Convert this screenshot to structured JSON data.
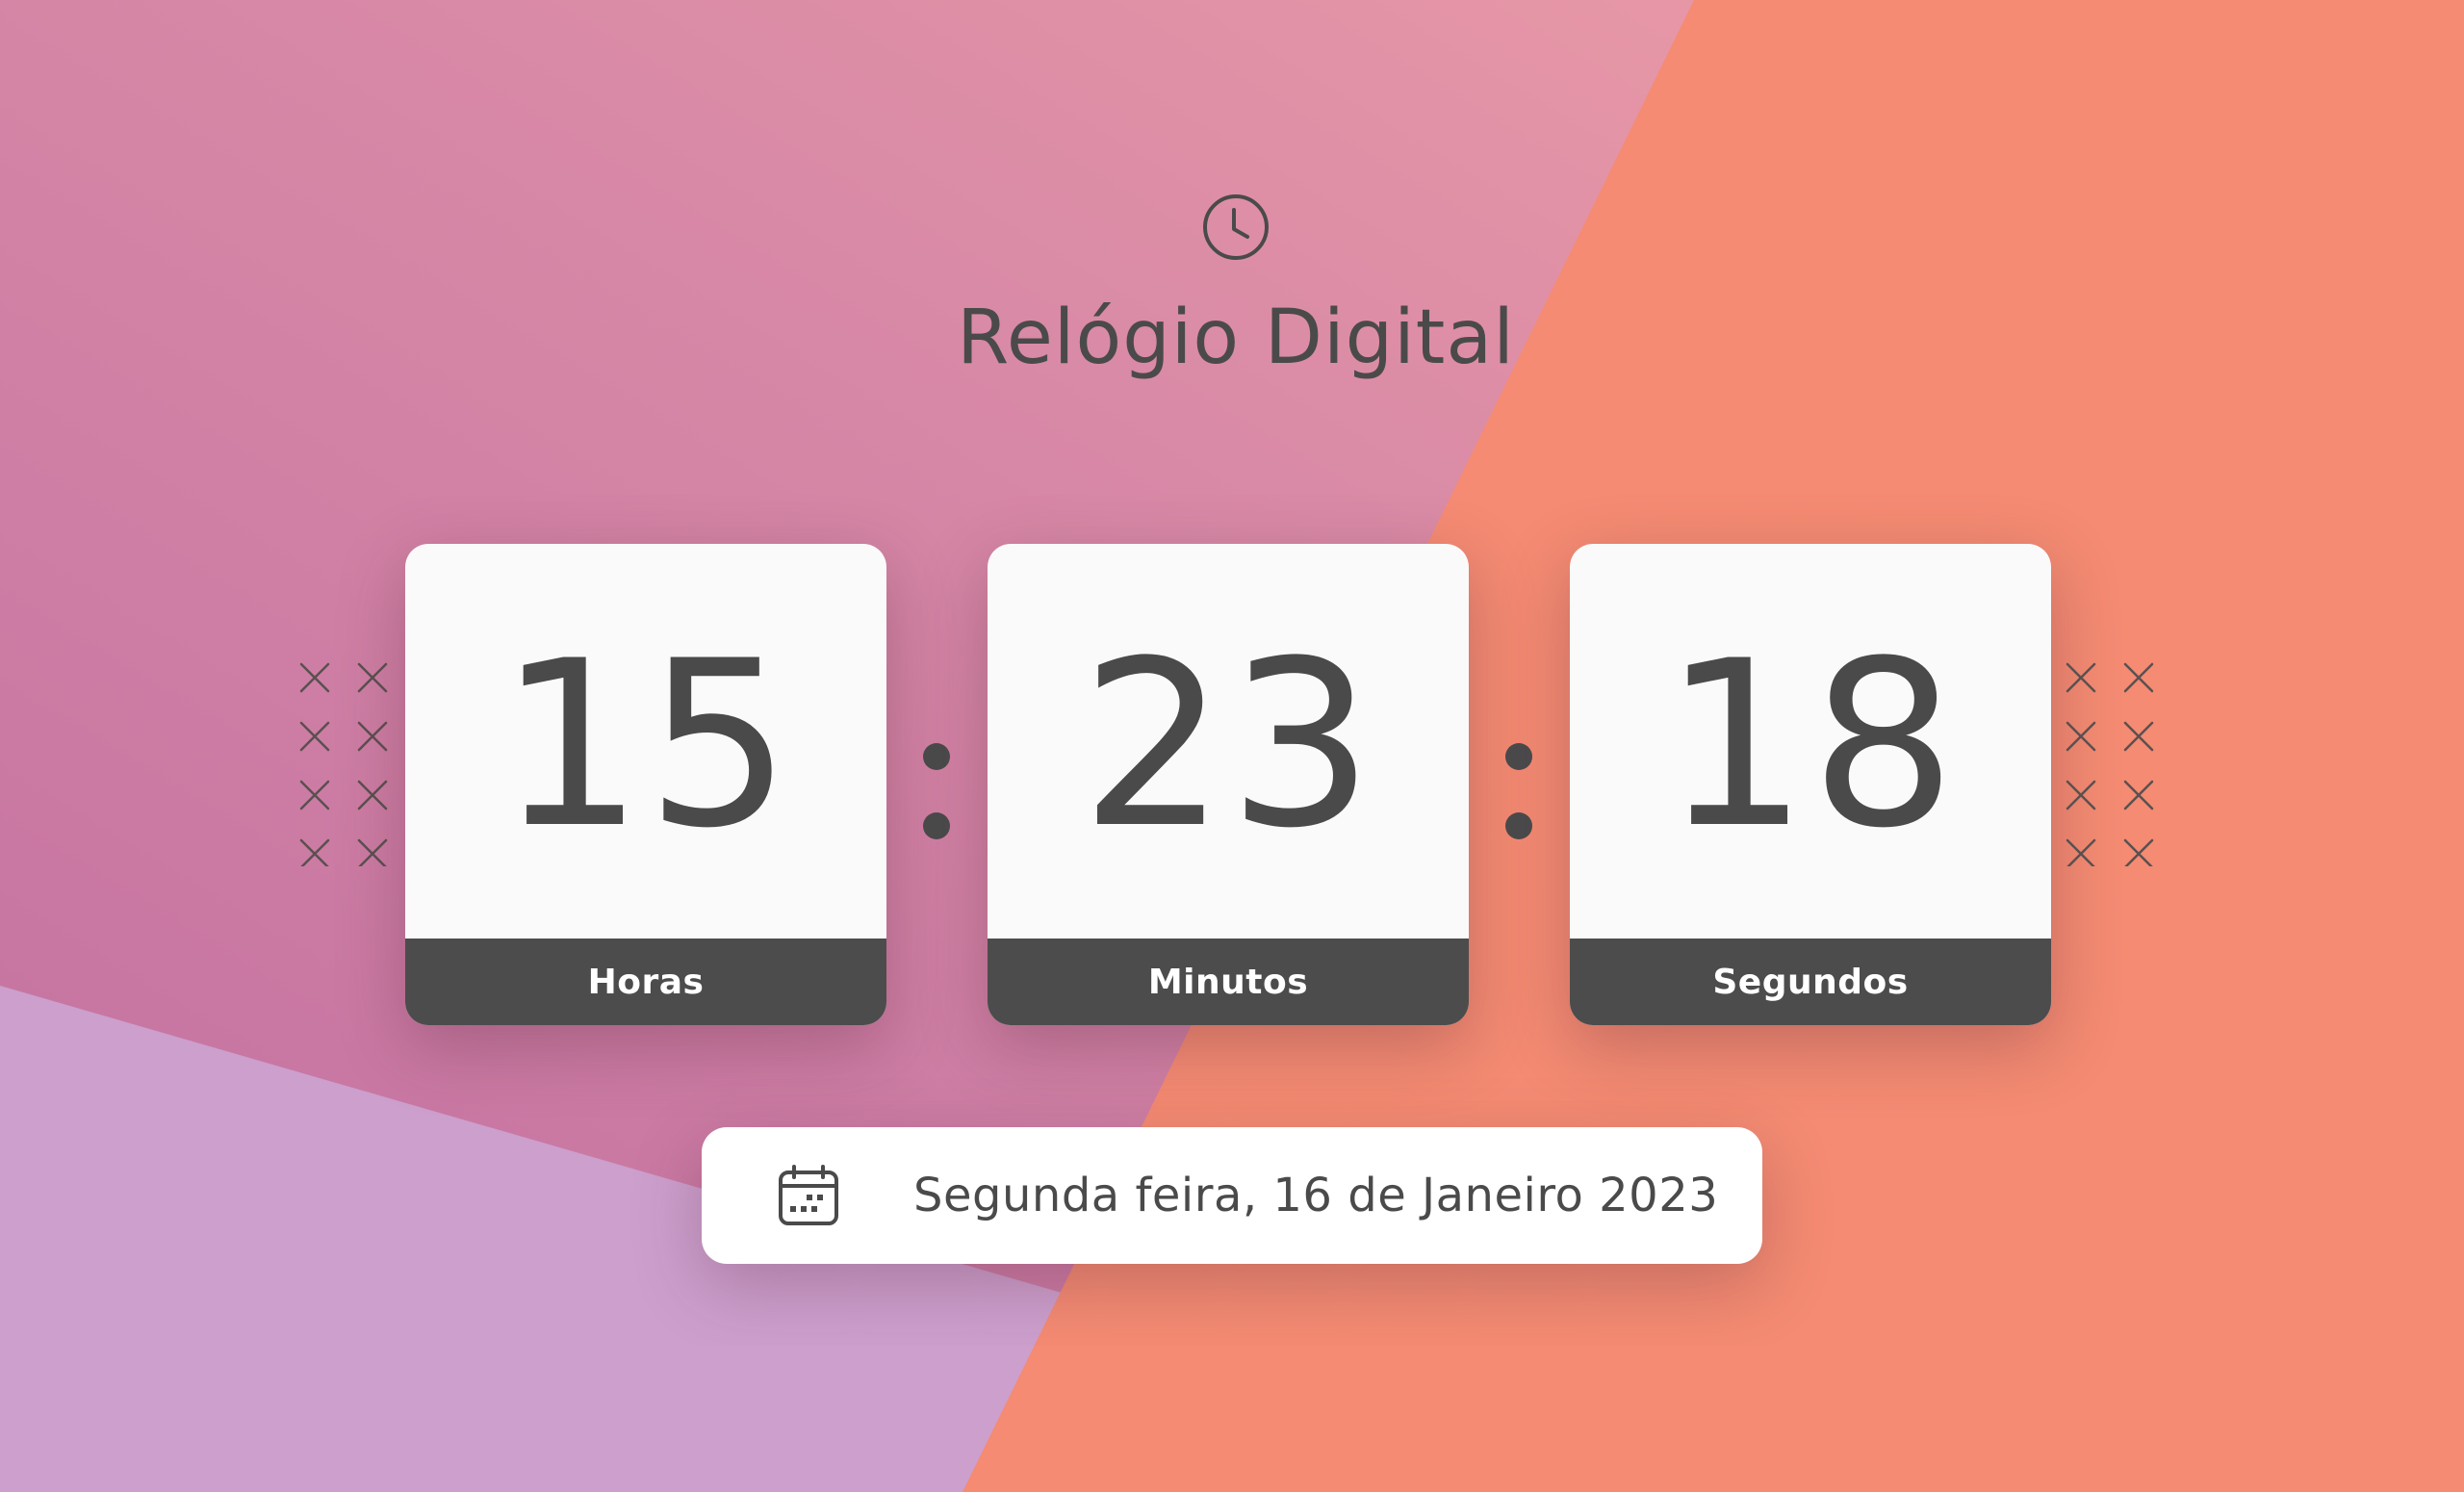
{
  "app": {
    "title": "Relógio Digital"
  },
  "clock": {
    "hours": {
      "value": "15",
      "label": "Horas"
    },
    "minutes": {
      "value": "23",
      "label": "Minutos"
    },
    "seconds": {
      "value": "18",
      "label": "Segundos"
    }
  },
  "date": {
    "text": "Segunda feira, 16 de Janeiro 2023"
  },
  "icons": {
    "header": "clock-icon",
    "date": "calendar-icon",
    "decoration": "x-mark-icon"
  },
  "colors": {
    "text_dark": "#4a4a4b",
    "card_bg": "#fafafa",
    "label_bg": "#4d4c4c",
    "bg_pink": "#c97aa3",
    "bg_lilac": "#cc9fcd",
    "bg_coral": "#f48970"
  }
}
